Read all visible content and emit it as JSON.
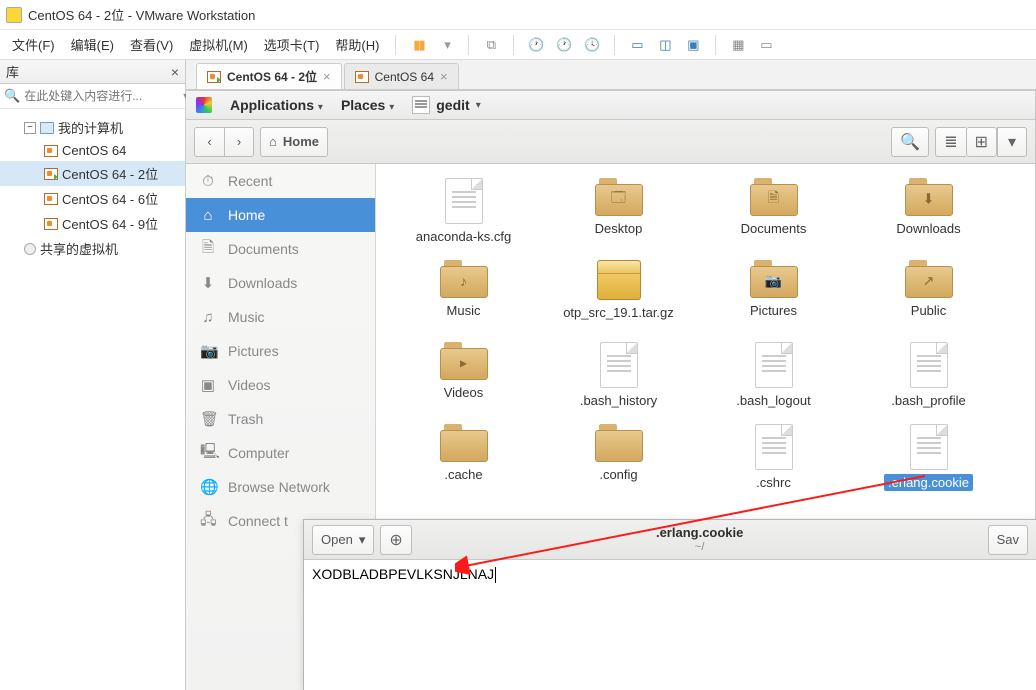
{
  "window": {
    "title": "CentOS 64 - 2位 - VMware Workstation"
  },
  "menubar": [
    "文件(F)",
    "编辑(E)",
    "查看(V)",
    "虚拟机(M)",
    "选项卡(T)",
    "帮助(H)"
  ],
  "library": {
    "header": "库",
    "search_placeholder": "在此处键入内容进行...",
    "root": "我的计算机",
    "vms": [
      "CentOS 64",
      "CentOS 64 - 2位",
      "CentOS 64 - 6位",
      "CentOS 64 - 9位"
    ],
    "shared": "共享的虚拟机"
  },
  "vm_tabs": [
    {
      "label": "CentOS 64 - 2位",
      "active": true
    },
    {
      "label": "CentOS 64",
      "active": false
    }
  ],
  "gnome_top": {
    "applications": "Applications",
    "places": "Places",
    "gedit": "gedit"
  },
  "nautilus": {
    "location": "Home",
    "sidebar": [
      "Recent",
      "Home",
      "Documents",
      "Downloads",
      "Music",
      "Pictures",
      "Videos",
      "Trash",
      "Computer",
      "Browse Network",
      "Connect t"
    ],
    "sidebar_icons": [
      "⏱",
      "⌂",
      "🗎",
      "⬇",
      "♫",
      "📷",
      "▣",
      "🗑",
      "🖳",
      "🌐",
      "🖧"
    ],
    "files": [
      {
        "name": "anaconda-ks.cfg",
        "type": "file"
      },
      {
        "name": "Desktop",
        "type": "folder",
        "ovl": "🗔"
      },
      {
        "name": "Documents",
        "type": "folder",
        "ovl": "🗎"
      },
      {
        "name": "Downloads",
        "type": "folder",
        "ovl": "⬇"
      },
      {
        "name": "Music",
        "type": "folder",
        "ovl": "♪"
      },
      {
        "name": "otp_src_19.1.tar.gz",
        "type": "pkg"
      },
      {
        "name": "Pictures",
        "type": "folder",
        "ovl": "📷"
      },
      {
        "name": "Public",
        "type": "folder",
        "ovl": "↗"
      },
      {
        "name": "Videos",
        "type": "folder",
        "ovl": "▸"
      },
      {
        "name": ".bash_history",
        "type": "file"
      },
      {
        "name": ".bash_logout",
        "type": "file"
      },
      {
        "name": ".bash_profile",
        "type": "file"
      },
      {
        "name": ".cache",
        "type": "folder"
      },
      {
        "name": ".config",
        "type": "folder"
      },
      {
        "name": ".cshrc",
        "type": "file"
      },
      {
        "name": ".erlang.cookie",
        "type": "file",
        "selected": true
      }
    ]
  },
  "gedit": {
    "open_label": "Open",
    "save_label": "Sav",
    "title": ".erlang.cookie",
    "subtitle": "~/",
    "content": "XODBLADBPEVLKSNJLNAJ"
  }
}
